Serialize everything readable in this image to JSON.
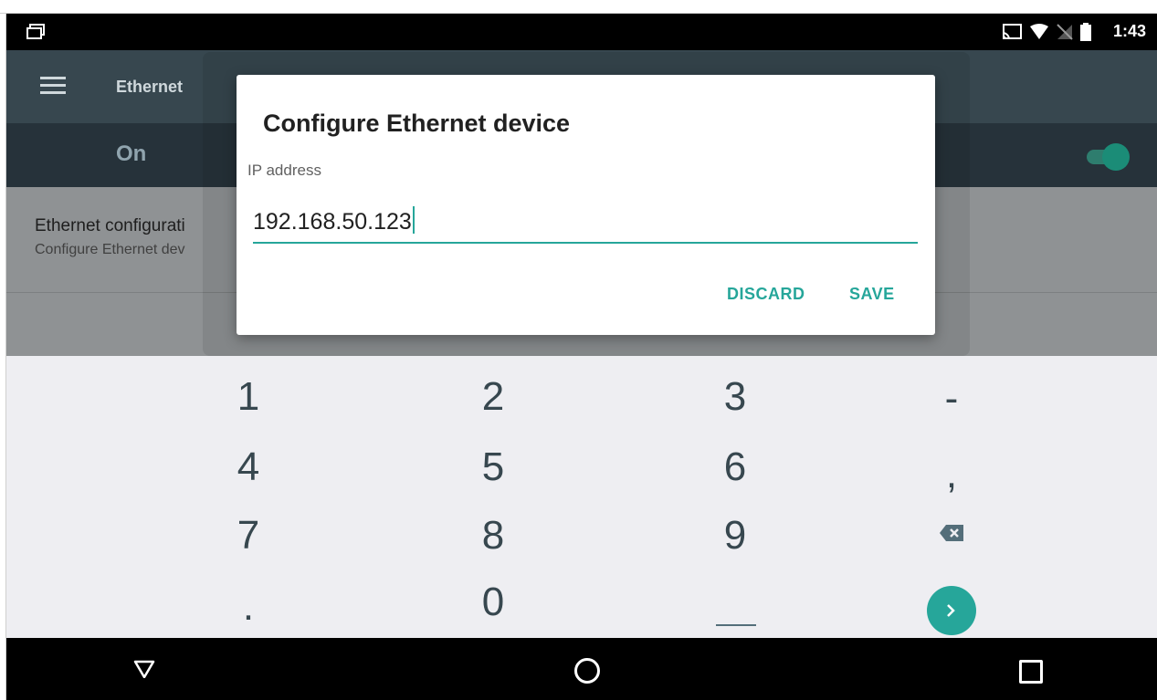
{
  "status_bar": {
    "time": "1:43",
    "icons": [
      "cast-icon",
      "wifi-icon",
      "no-signal-icon",
      "battery-icon"
    ]
  },
  "app_bar": {
    "title": "Ethernet",
    "menu_icon": "hamburger-menu-icon"
  },
  "switch_bar": {
    "label": "On",
    "toggle_state": "on"
  },
  "list": {
    "item_title": "Ethernet configurati",
    "item_subtitle": "Configure Ethernet dev"
  },
  "dialog": {
    "title": "Configure Ethernet device",
    "field_label": "IP address",
    "field_value": "192.168.50.123",
    "discard_label": "DISCARD",
    "save_label": "SAVE"
  },
  "keypad": {
    "keys": [
      "1",
      "2",
      "3",
      "-",
      "4",
      "5",
      "6",
      ",",
      "7",
      "8",
      "9",
      "backspace",
      ".",
      "0",
      "space",
      "go"
    ]
  },
  "colors": {
    "accent": "#26a69a",
    "app_bar": "#37474f",
    "status_bar": "#000000",
    "keypad_bg": "#eeeef2"
  }
}
